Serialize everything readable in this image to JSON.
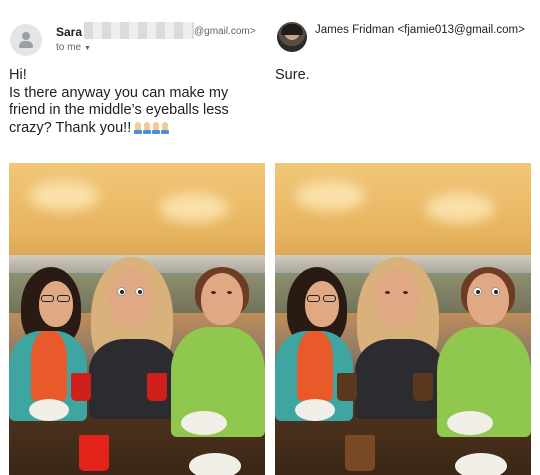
{
  "left_email": {
    "sender_name": "Sara",
    "sender_email_domain": "@gmail.com>",
    "to_line": "to me",
    "message_lines": [
      "Hi!",
      "Is there anyway you can make my friend in the middle’s eyeballs less crazy? Thank you!!"
    ],
    "emoji": "folded-hands-emoji"
  },
  "right_email": {
    "sender_name": "James Fridman",
    "sender_email": "<fjamie013@gmail.com>",
    "reply": "Sure."
  },
  "colors": {
    "text": "#202124",
    "secondary_text": "#5f6368",
    "masked_email": "#d9dcdf"
  },
  "icons": {
    "sender_avatar": "person-avatar-icon",
    "reply_avatar": "profile-photo-avatar",
    "to_me_caret": "chevron-down-icon"
  }
}
